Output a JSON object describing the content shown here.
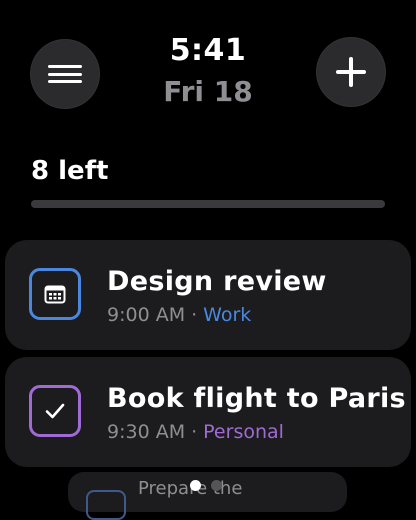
{
  "header": {
    "time": "5:41",
    "date": "Fri 18",
    "menu_icon": "hamburger-menu-icon",
    "add_icon": "plus-icon"
  },
  "summary": {
    "remaining_label": "8 left",
    "progress_fraction": 0.0
  },
  "tasks": [
    {
      "title": "Design review",
      "time": "9:00 AM",
      "separator": "·",
      "category": "Work",
      "icon": "calendar-icon",
      "accent": "#4a88e0"
    },
    {
      "title": "Book flight to Paris",
      "time": "9:30 AM",
      "separator": "·",
      "category": "Personal",
      "icon": "checkbox-icon",
      "accent": "#a06bd6"
    },
    {
      "title": "Prepare the",
      "icon": "calendar-icon",
      "accent": "#3f5a8a"
    }
  ],
  "pager": {
    "page_count": 2,
    "active_index": 0
  },
  "colors": {
    "background": "#000000",
    "card": "#1c1c1e",
    "button": "#2b2b2e",
    "muted_text": "#8e8e93"
  }
}
